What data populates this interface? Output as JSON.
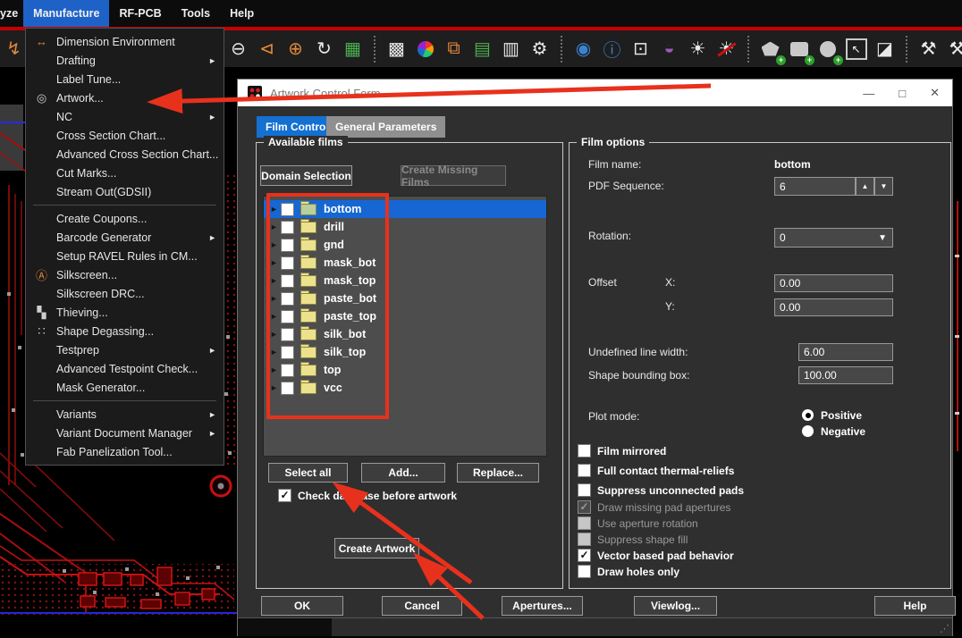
{
  "menubar": {
    "items": [
      {
        "label": "yze"
      },
      {
        "label": "Manufacture",
        "active": true
      },
      {
        "label": "RF-PCB"
      },
      {
        "label": "Tools"
      },
      {
        "label": "Help"
      }
    ]
  },
  "menu": {
    "items": [
      {
        "icon": "↔",
        "label": "Dimension Environment"
      },
      {
        "label": "Drafting",
        "submenu": "►"
      },
      {
        "label": "Label Tune..."
      },
      {
        "icon": "◎",
        "label": "Artwork..."
      },
      {
        "label": "NC",
        "submenu": "►"
      },
      {
        "label": "Cross Section Chart..."
      },
      {
        "label": "Advanced Cross Section Chart..."
      },
      {
        "label": "Cut Marks..."
      },
      {
        "label": "Stream Out(GDSII)"
      },
      {
        "label": "Create Coupons..."
      },
      {
        "label": "Barcode Generator",
        "submenu": "►"
      },
      {
        "label": "Setup RAVEL Rules in CM..."
      },
      {
        "icon": "Ⓐ",
        "label": "Silkscreen..."
      },
      {
        "label": "Silkscreen DRC..."
      },
      {
        "icon": "▚",
        "label": "Thieving..."
      },
      {
        "icon": "∷",
        "label": "Shape Degassing..."
      },
      {
        "label": "Testprep",
        "submenu": "►"
      },
      {
        "label": "Advanced Testpoint Check..."
      },
      {
        "label": "Mask Generator..."
      },
      {
        "label": "Variants",
        "submenu": "►"
      },
      {
        "label": "Variant Document Manager",
        "submenu": "►"
      },
      {
        "label": "Fab Panelization Tool..."
      }
    ]
  },
  "toolbar": {
    "icons": [
      {
        "name": "route-icon",
        "glyph": "↯"
      },
      {
        "name": "zoom-out-icon",
        "glyph": "⊖"
      },
      {
        "name": "zoom-previous-icon",
        "glyph": "⊲"
      },
      {
        "name": "zoom-fit-icon",
        "glyph": "⊕"
      },
      {
        "name": "redraw-icon",
        "glyph": "↻"
      },
      {
        "name": "board-icon",
        "glyph": "▦"
      },
      {
        "name": "grid-toggle-icon",
        "glyph": "▩"
      },
      {
        "name": "color-wheel-icon",
        "glyph": ""
      },
      {
        "name": "layer-visibility-icon",
        "glyph": "⧉"
      },
      {
        "name": "cross-section-icon",
        "glyph": "▤"
      },
      {
        "name": "film-report-icon",
        "glyph": "▥"
      },
      {
        "name": "parameters-icon",
        "glyph": "⚙"
      },
      {
        "name": "eye-visibility-icon",
        "glyph": "◉"
      },
      {
        "name": "object-info-icon",
        "glyph": "ⓘ"
      },
      {
        "name": "measure-3d-icon",
        "glyph": "⊡"
      },
      {
        "name": "palette-icon",
        "glyph": "◒"
      },
      {
        "name": "shadow-on-icon",
        "glyph": "☀"
      },
      {
        "name": "shadow-off-icon",
        "glyph": "☀"
      },
      {
        "name": "add-polygon-icon",
        "glyph": ""
      },
      {
        "name": "add-rect-icon",
        "glyph": ""
      },
      {
        "name": "add-circle-icon",
        "glyph": ""
      },
      {
        "name": "select-box-icon",
        "glyph": "↖"
      },
      {
        "name": "invert-icon",
        "glyph": "◪"
      },
      {
        "name": "drill-legend-icon",
        "glyph": "⚒"
      },
      {
        "name": "drill-customize-icon",
        "glyph": "⚒"
      },
      {
        "name": "clipboard-icon",
        "glyph": "▯"
      }
    ]
  },
  "dialog": {
    "title": "Artwork Control Form",
    "window_buttons": {
      "minimize": "—",
      "maximize": "□",
      "close": "✕"
    },
    "tabs": [
      {
        "label": "Film Control",
        "active": true
      },
      {
        "label": "General Parameters",
        "active": false
      }
    ],
    "available_films": {
      "legend": "Available films",
      "domain_selection": "Domain Selection",
      "create_missing_films": "Create Missing Films",
      "films": [
        {
          "name": "bottom",
          "selected": true
        },
        {
          "name": "drill"
        },
        {
          "name": "gnd"
        },
        {
          "name": "mask_bot"
        },
        {
          "name": "mask_top"
        },
        {
          "name": "paste_bot"
        },
        {
          "name": "paste_top"
        },
        {
          "name": "silk_bot"
        },
        {
          "name": "silk_top"
        },
        {
          "name": "top"
        },
        {
          "name": "vcc"
        }
      ],
      "select_all": "Select all",
      "add": "Add...",
      "replace": "Replace...",
      "check_database": "Check database before artwork",
      "check_database_checked": true,
      "create_artwork": "Create Artwork"
    },
    "film_options": {
      "legend": "Film options",
      "film_name_label": "Film name:",
      "film_name": "bottom",
      "pdf_sequence_label": "PDF Sequence:",
      "pdf_sequence": "6",
      "rotation_label": "Rotation:",
      "rotation": "0",
      "offset_label": "Offset",
      "x_label": "X:",
      "offset_x": "0.00",
      "y_label": "Y:",
      "offset_y": "0.00",
      "undefined_line_width_label": "Undefined line width:",
      "undefined_line_width": "6.00",
      "shape_bounding_box_label": "Shape bounding box:",
      "shape_bounding_box": "100.00",
      "plot_mode_label": "Plot mode:",
      "plot_positive": "Positive",
      "plot_negative": "Negative",
      "plot_mode_selected": "Positive",
      "checkboxes": [
        {
          "label": "Film mirrored",
          "checked": false,
          "enabled": true
        },
        {
          "label": "Full contact thermal-reliefs",
          "checked": false,
          "enabled": true
        },
        {
          "label": "Suppress unconnected pads",
          "checked": false,
          "enabled": true
        },
        {
          "label": "Draw missing pad apertures",
          "checked": true,
          "enabled": false
        },
        {
          "label": "Use aperture rotation",
          "checked": false,
          "enabled": false
        },
        {
          "label": "Suppress shape fill",
          "checked": false,
          "enabled": false
        },
        {
          "label": "Vector based pad behavior",
          "checked": true,
          "enabled": true
        },
        {
          "label": "Draw holes only",
          "checked": false,
          "enabled": true
        }
      ]
    },
    "footer": {
      "ok": "OK",
      "cancel": "Cancel",
      "apertures": "Apertures...",
      "viewlog": "Viewlog...",
      "help": "Help"
    }
  },
  "annotations": {
    "arrow_color": "#e8311c",
    "highlight_box_color": "#e8311c"
  },
  "canvas": {
    "trace_color": "#c41111",
    "board_outline_color": "#2525dd",
    "pad_color": "#5c0202"
  }
}
